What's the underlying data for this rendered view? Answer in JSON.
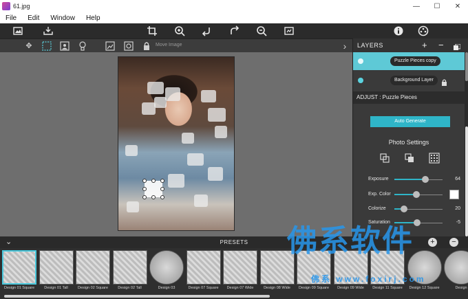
{
  "window": {
    "title": "61.jpg",
    "minimize": "—",
    "maximize": "☐",
    "close": "✕"
  },
  "menu": [
    "File",
    "Edit",
    "Window",
    "Help"
  ],
  "toolbar": {
    "icons": [
      "image-icon",
      "tray-icon",
      "crop-icon",
      "zoom-in-icon",
      "undo-icon",
      "redo-icon",
      "zoom-out-icon",
      "fit-icon",
      "info-icon",
      "palette-icon"
    ]
  },
  "subtoolbar": {
    "move_label": "Move Image",
    "expand": "›"
  },
  "layers": {
    "title": "LAYERS",
    "add": "+",
    "remove": "−",
    "rows": [
      {
        "name": "Puzzle Pieces copy",
        "active": true,
        "locked": false
      },
      {
        "name": "Background Layer",
        "active": false,
        "locked": true
      }
    ]
  },
  "adjust": {
    "title": "ADJUST : Puzzle Pieces",
    "auto_button": "Auto Generate",
    "photo_settings": "Photo Settings",
    "sliders": [
      {
        "label": "Exposure",
        "value": "64",
        "fraction": 0.64
      },
      {
        "label": "Exp. Color",
        "value": "",
        "fraction": 0.45
      },
      {
        "label": "Colorize",
        "value": "20",
        "fraction": 0.2
      },
      {
        "label": "Saturation",
        "value": "-5",
        "fraction": 0.47
      }
    ]
  },
  "presets": {
    "title": "PRESETS",
    "collapse": "⌄",
    "items": [
      {
        "caption": "Design 01 Square",
        "shape": "square",
        "selected": true
      },
      {
        "caption": "Design 01 Tall",
        "shape": "square",
        "selected": false
      },
      {
        "caption": "Design 02 Square",
        "shape": "square",
        "selected": false
      },
      {
        "caption": "Design 02 Tall",
        "shape": "square",
        "selected": false
      },
      {
        "caption": "Design 03",
        "shape": "round",
        "selected": false
      },
      {
        "caption": "Design 07 Square",
        "shape": "square",
        "selected": false
      },
      {
        "caption": "Design 07 Wide",
        "shape": "square",
        "selected": false
      },
      {
        "caption": "Design 08 Wide",
        "shape": "square",
        "selected": false
      },
      {
        "caption": "Design 09 Square",
        "shape": "square",
        "selected": false
      },
      {
        "caption": "Design 09 Wide",
        "shape": "square",
        "selected": false
      },
      {
        "caption": "Design 11 Square",
        "shape": "square",
        "selected": false
      },
      {
        "caption": "Design 12 Square",
        "shape": "round",
        "selected": false
      },
      {
        "caption": "Design",
        "shape": "round",
        "selected": false
      }
    ]
  },
  "watermark": {
    "text": "佛系软件",
    "url": "佛系 www.foxirj.com"
  },
  "colors": {
    "accent": "#2fb5c8",
    "layer_active": "#5bd3df",
    "panel": "#3a3a3a",
    "toolbar": "#2b2b2b"
  }
}
